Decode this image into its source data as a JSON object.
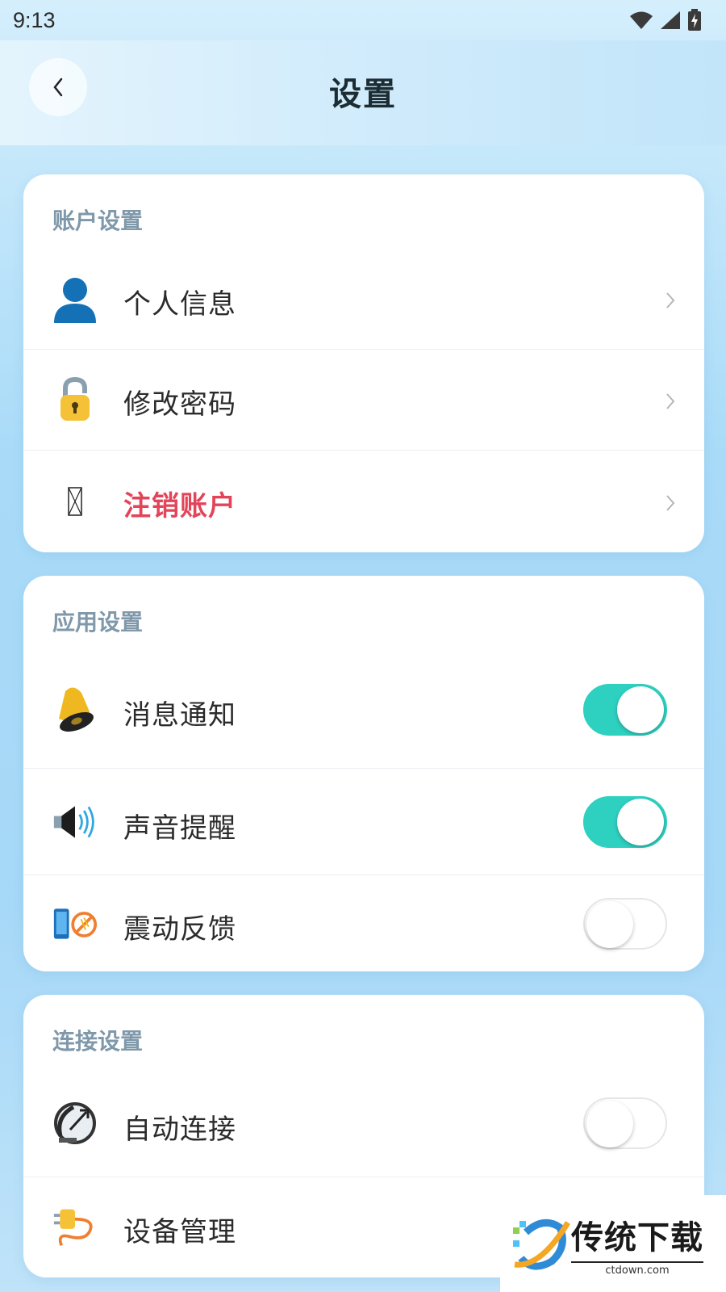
{
  "status_bar": {
    "time": "9:13"
  },
  "header": {
    "title": "设置"
  },
  "sections": [
    {
      "title": "账户设置",
      "items": [
        {
          "label": "个人信息",
          "icon": "user-icon"
        },
        {
          "label": "修改密码",
          "icon": "lock-icon"
        },
        {
          "label": "注销账户",
          "icon": "missing-glyph-icon",
          "color": "#e2455a"
        }
      ]
    },
    {
      "title": "应用设置",
      "items": [
        {
          "label": "消息通知",
          "icon": "bell-icon",
          "toggle": true
        },
        {
          "label": "声音提醒",
          "icon": "speaker-icon",
          "toggle": true
        },
        {
          "label": "震动反馈",
          "icon": "vibration-off-icon",
          "toggle": false
        }
      ]
    },
    {
      "title": "连接设置",
      "items": [
        {
          "label": "自动连接",
          "icon": "satellite-dish-icon",
          "toggle": false
        },
        {
          "label": "设备管理",
          "icon": "plug-icon"
        }
      ]
    }
  ],
  "watermark": {
    "brand": "传统下载",
    "domain": "ctdown.com"
  },
  "colors": {
    "accent": "#2ed0c0",
    "danger": "#e2455a",
    "section_title": "#7f98aa"
  }
}
